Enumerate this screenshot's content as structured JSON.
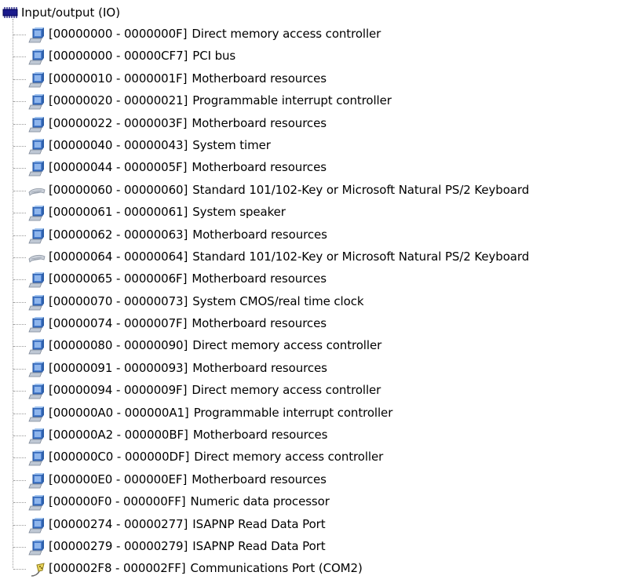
{
  "tree": {
    "root": {
      "label": "Input/output (IO)",
      "icon": "io-chip-icon"
    },
    "items": [
      {
        "range": "[00000000 - 0000000F]",
        "name": "Direct memory access controller",
        "icon": "system-device-icon"
      },
      {
        "range": "[00000000 - 00000CF7]",
        "name": "PCI bus",
        "icon": "system-device-icon"
      },
      {
        "range": "[00000010 - 0000001F]",
        "name": "Motherboard resources",
        "icon": "system-device-icon"
      },
      {
        "range": "[00000020 - 00000021]",
        "name": "Programmable interrupt controller",
        "icon": "system-device-icon"
      },
      {
        "range": "[00000022 - 0000003F]",
        "name": "Motherboard resources",
        "icon": "system-device-icon"
      },
      {
        "range": "[00000040 - 00000043]",
        "name": "System timer",
        "icon": "system-device-icon"
      },
      {
        "range": "[00000044 - 0000005F]",
        "name": "Motherboard resources",
        "icon": "system-device-icon"
      },
      {
        "range": "[00000060 - 00000060]",
        "name": "Standard 101/102-Key or Microsoft Natural PS/2 Keyboard",
        "icon": "keyboard-icon"
      },
      {
        "range": "[00000061 - 00000061]",
        "name": "System speaker",
        "icon": "system-device-icon"
      },
      {
        "range": "[00000062 - 00000063]",
        "name": "Motherboard resources",
        "icon": "system-device-icon"
      },
      {
        "range": "[00000064 - 00000064]",
        "name": "Standard 101/102-Key or Microsoft Natural PS/2 Keyboard",
        "icon": "keyboard-icon"
      },
      {
        "range": "[00000065 - 0000006F]",
        "name": "Motherboard resources",
        "icon": "system-device-icon"
      },
      {
        "range": "[00000070 - 00000073]",
        "name": "System CMOS/real time clock",
        "icon": "system-device-icon"
      },
      {
        "range": "[00000074 - 0000007F]",
        "name": "Motherboard resources",
        "icon": "system-device-icon"
      },
      {
        "range": "[00000080 - 00000090]",
        "name": "Direct memory access controller",
        "icon": "system-device-icon"
      },
      {
        "range": "[00000091 - 00000093]",
        "name": "Motherboard resources",
        "icon": "system-device-icon"
      },
      {
        "range": "[00000094 - 0000009F]",
        "name": "Direct memory access controller",
        "icon": "system-device-icon"
      },
      {
        "range": "[000000A0 - 000000A1]",
        "name": "Programmable interrupt controller",
        "icon": "system-device-icon"
      },
      {
        "range": "[000000A2 - 000000BF]",
        "name": "Motherboard resources",
        "icon": "system-device-icon"
      },
      {
        "range": "[000000C0 - 000000DF]",
        "name": "Direct memory access controller",
        "icon": "system-device-icon"
      },
      {
        "range": "[000000E0 - 000000EF]",
        "name": "Motherboard resources",
        "icon": "system-device-icon"
      },
      {
        "range": "[000000F0 - 000000FF]",
        "name": "Numeric data processor",
        "icon": "system-device-icon"
      },
      {
        "range": "[00000274 - 00000277]",
        "name": "ISAPNP Read Data Port",
        "icon": "system-device-icon"
      },
      {
        "range": "[00000279 - 00000279]",
        "name": "ISAPNP Read Data Port",
        "icon": "system-device-icon"
      },
      {
        "range": "[000002F8 - 000002FF]",
        "name": "Communications Port (COM2)",
        "icon": "serial-port-icon"
      }
    ]
  }
}
